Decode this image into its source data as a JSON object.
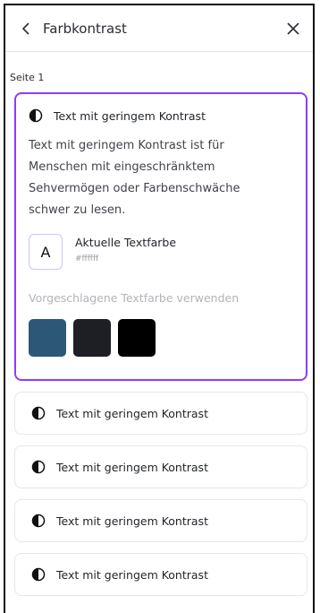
{
  "header": {
    "title": "Farbkontrast",
    "back_icon": "chevron-left-icon",
    "close_icon": "close-icon"
  },
  "section": {
    "label": "Seite 1"
  },
  "expanded_issue": {
    "title": "Text mit geringem Kontrast",
    "description": "Text mit geringem Kontrast ist für Menschen mit eingeschränktem Sehvermögen oder Farbenschwäche schwer zu lesen.",
    "current_color": {
      "swatch_letter": "A",
      "label": "Aktuelle Textfarbe",
      "hex": "#ffffff"
    },
    "suggest_label": "Vorgeschlagene Textfarbe verwenden",
    "suggested_colors": [
      "#2d5777",
      "#1d1f24",
      "#000000"
    ]
  },
  "other_issues": [
    {
      "title": "Text mit geringem Kontrast"
    },
    {
      "title": "Text mit geringem Kontrast"
    },
    {
      "title": "Text mit geringem Kontrast"
    },
    {
      "title": "Text mit geringem Kontrast"
    }
  ],
  "colors": {
    "accent": "#8b3dff"
  }
}
